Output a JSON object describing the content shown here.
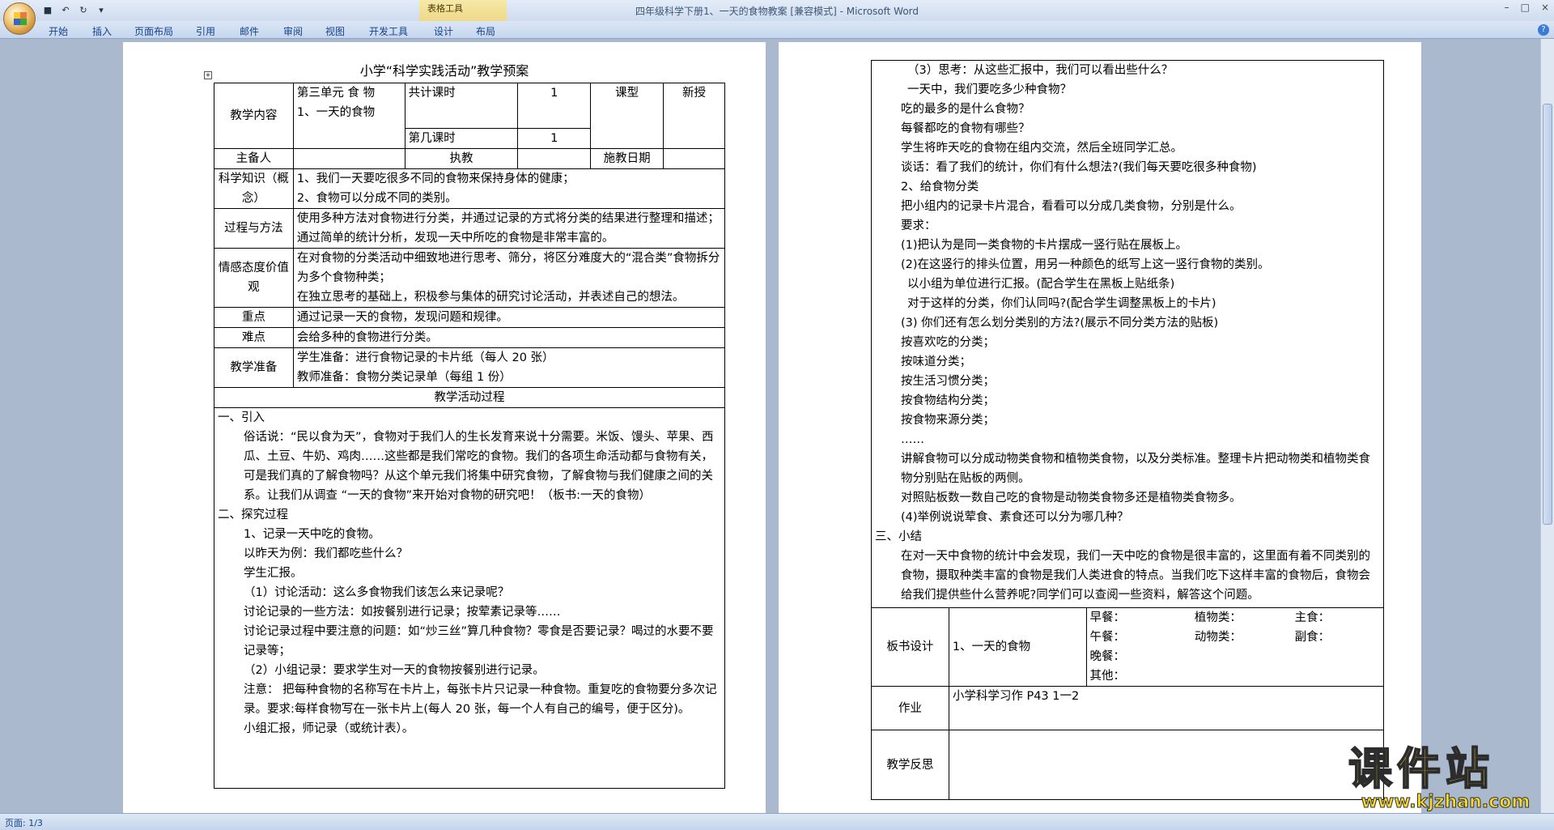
{
  "window": {
    "title": "四年级科学下册1、一天的食物教案 [兼容模式] - Microsoft Word",
    "contextual_tab_group": "表格工具",
    "minimize": "–",
    "maximize": "□",
    "close": "×"
  },
  "ribbon_tabs": [
    "开始",
    "插入",
    "页面布局",
    "引用",
    "邮件",
    "审阅",
    "视图",
    "开发工具",
    "设计",
    "布局"
  ],
  "help_label": "?",
  "statusbar": {
    "page": "页面: 1/3"
  },
  "page1": {
    "doc_title": "小学“科学实践活动”教学预案",
    "row1": {
      "label": "教学内容",
      "unit": "第三单元  食 物",
      "lesson": "1、一天的食物",
      "total_label": "共计课时",
      "total_value": "1",
      "which_label": "第几课时",
      "which_value": "1",
      "type_label": "课型",
      "type_value": "新授"
    },
    "row2": {
      "preparer_label": "主备人",
      "teacher_label": "执教",
      "date_label": "施教日期"
    },
    "knowledge": {
      "label": "科学知识（概念）",
      "lines": [
        "1、我们一天要吃很多不同的食物来保持身体的健康；",
        "2、食物可以分成不同的类别。"
      ]
    },
    "process": {
      "label": "过程与方法",
      "lines": [
        "使用多种方法对食物进行分类，并通过记录的方式将分类的结果进行整理和描述；",
        "通过简单的统计分析，发现一天中所吃的食物是非常丰富的。"
      ]
    },
    "attitude": {
      "label": "情感态度价值观",
      "lines": [
        "在对食物的分类活动中细致地进行思考、筛分，将区分难度大的“混合类”食物拆分为多个食物种类；",
        "在独立思考的基础上，积极参与集体的研究讨论活动，并表述自己的想法。"
      ]
    },
    "key": {
      "label": "重点",
      "text": "通过记录一天的食物，发现问题和规律。"
    },
    "difficulty": {
      "label": "难点",
      "text": "会给多种的食物进行分类。"
    },
    "preparation": {
      "label": "教学准备",
      "lines": [
        "学生准备：进行食物记录的卡片纸（每人 20 张）",
        "教师准备：食物分类记录单（每组 1 份）"
      ]
    },
    "process_header": "教学活动过程",
    "body": [
      {
        "t": "一、引入",
        "c": ""
      },
      {
        "t": "俗话说：“民以食为天”，食物对于我们人的生长发育来说十分需要。米饭、馒头、苹果、西瓜、土豆、牛奶、鸡肉……这些都是我们常吃的食物。我们的各项生命活动都与食物有关，可是我们真的了解食物吗？从这个单元我们将集中研究食物，了解食物与我们健康之间的关系。让我们从调查 “一天的食物”来开始对食物的研究吧！（板书:一天的食物）",
        "c": "ind"
      },
      {
        "t": "二、探究过程",
        "c": ""
      },
      {
        "t": "1、记录一天中吃的食物。",
        "c": "ind"
      },
      {
        "t": "以昨天为例：我们都吃些什么？",
        "c": "ind"
      },
      {
        "t": "学生汇报。",
        "c": "ind"
      },
      {
        "t": "（1）讨论活动：这么多食物我们该怎么来记录呢？",
        "c": "ind"
      },
      {
        "t": "讨论记录的一些方法：如按餐别进行记录；按荤素记录等……",
        "c": "ind"
      },
      {
        "t": "讨论记录过程中要注意的问题：如“炒三丝”算几种食物？零食是否要记录？喝过的水要不要记录等；",
        "c": "ind"
      },
      {
        "t": "（2）小组记录：要求学生对一天的食物按餐别进行记录。",
        "c": "ind"
      },
      {
        "t": "注意： 把每种食物的名称写在卡片上，每张卡片只记录一种食物。重复吃的食物要分多次记录。要求:每样食物写在一张卡片上(每人 20 张，每一个人有自己的编号，便于区分)。",
        "c": "ind"
      },
      {
        "t": "小组汇报，师记录（或统计表）。",
        "c": "ind"
      }
    ]
  },
  "page2": {
    "body": [
      {
        "t": "（3）思考：从这些汇报中，我们可以看出些什么？",
        "c": "ind2"
      },
      {
        "t": "一天中，我们要吃多少种食物？",
        "c": "ind2"
      },
      {
        "t": "吃的最多的是什么食物？",
        "c": "ind"
      },
      {
        "t": "每餐都吃的食物有哪些？",
        "c": "ind"
      },
      {
        "t": "学生将昨天吃的食物在组内交流，然后全班同学汇总。",
        "c": "ind"
      },
      {
        "t": "谈话：看了我们的统计，你们有什么想法?(我们每天要吃很多种食物)",
        "c": "ind"
      },
      {
        "t": "2、给食物分类",
        "c": "ind"
      },
      {
        "t": "把小组内的记录卡片混合，看看可以分成几类食物，分别是什么。",
        "c": "ind"
      },
      {
        "t": "要求：",
        "c": "ind"
      },
      {
        "t": "(1)把认为是同一类食物的卡片摆成一竖行贴在展板上。",
        "c": "ind"
      },
      {
        "t": "(2)在这竖行的排头位置，用另一种颜色的纸写上这一竖行食物的类别。",
        "c": "ind"
      },
      {
        "t": "以小组为单位进行汇报。(配合学生在黑板上贴纸条)",
        "c": "ind2"
      },
      {
        "t": "对于这样的分类，你们认同吗?(配合学生调整黑板上的卡片)",
        "c": "ind2"
      },
      {
        "t": "(3) 你们还有怎么划分类别的方法?(展示不同分类方法的贴板)",
        "c": "ind"
      },
      {
        "t": "按喜欢吃的分类；",
        "c": "ind"
      },
      {
        "t": "按味道分类；",
        "c": "ind"
      },
      {
        "t": "按生活习惯分类；",
        "c": "ind"
      },
      {
        "t": "按食物结构分类；",
        "c": "ind"
      },
      {
        "t": "按食物来源分类；",
        "c": "ind"
      },
      {
        "t": "……",
        "c": "ind"
      },
      {
        "t": "讲解食物可以分成动物类食物和植物类食物，以及分类标准。整理卡片把动物类和植物类食物分别贴在贴板的两侧。",
        "c": "ind"
      },
      {
        "t": "对照贴板数一数自己吃的食物是动物类食物多还是植物类食物多。",
        "c": "ind"
      },
      {
        "t": "(4)举例说说荤食、素食还可以分为哪几种？",
        "c": "ind"
      },
      {
        "t": "三、小结",
        "c": ""
      },
      {
        "t": "在对一天中食物的统计中会发现，我们一天中吃的食物是很丰富的，这里面有着不同类别的食物，摄取种类丰富的食物是我们人类进食的特点。当我们吃下这样丰富的食物后，食物会给我们提供些什么营养呢?同学们可以查阅一些资料，解答这个问题。",
        "c": "ind"
      }
    ],
    "board": {
      "label": "板书设计",
      "lesson": "1、一天的食物",
      "breakfast": "早餐：",
      "lunch": "午餐：",
      "dinner": "晚餐：",
      "other": "其他：",
      "plant": "植物类：",
      "animal": "动物类：",
      "staple": "主食：",
      "side": "副食："
    },
    "homework": {
      "label": "作业",
      "text": "小学科学习作 P43 1一2"
    },
    "reflection": {
      "label": "教学反思"
    }
  },
  "watermark": {
    "logo": "课件站",
    "url": "www.kjzhan.com"
  }
}
